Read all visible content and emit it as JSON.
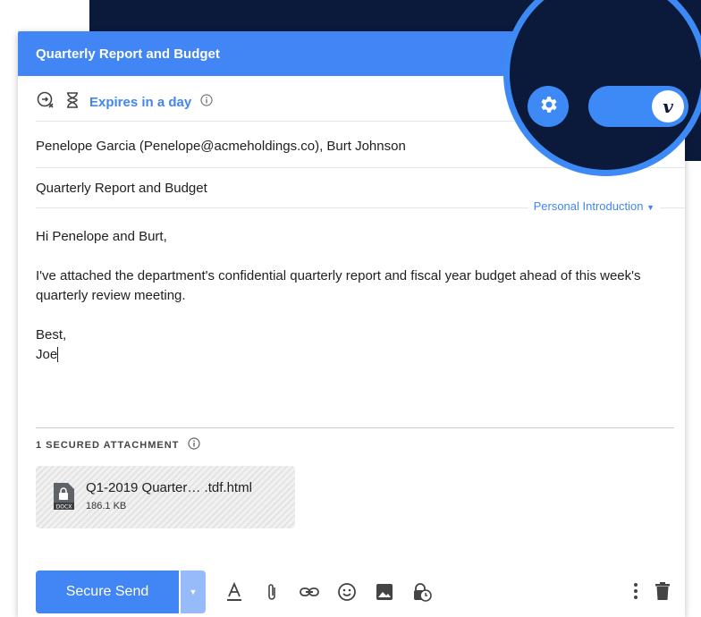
{
  "compose": {
    "title": "Quarterly Report and Budget",
    "expires_label": "Expires in a day",
    "to": "Penelope Garcia (Penelope@acmeholdings.co), Burt Johnson",
    "subject": "Quarterly Report and Budget",
    "template_select": "Personal Introduction",
    "body": {
      "greeting": "Hi Penelope and Burt,",
      "paragraph": "I've attached the department's confidential quarterly report and fiscal year budget ahead of this week's quarterly review meeting.",
      "signoff": "Best,",
      "signature": "Joe"
    },
    "attachments": {
      "label": "1 SECURED ATTACHMENT",
      "items": [
        {
          "name": "Q1-2019 Quarter… .tdf.html",
          "size": "186.1 KB",
          "type_badge": "DOCX"
        }
      ]
    },
    "toolbar": {
      "send_label": "Secure Send",
      "icons": [
        "format-text-icon",
        "attach-icon",
        "link-icon",
        "emoji-icon",
        "image-icon",
        "lock-clock-icon",
        "more-vert-icon",
        "trash-icon"
      ]
    }
  },
  "overlay": {
    "knob_letter": "v"
  },
  "colors": {
    "accent": "#4285f4",
    "dark_bg": "#0b1a3b",
    "ring": "#3d8af7"
  }
}
